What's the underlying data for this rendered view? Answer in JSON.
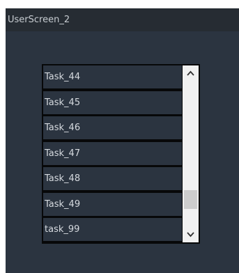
{
  "window": {
    "title": "UserScreen_2"
  },
  "list": {
    "items": [
      {
        "label": "Task_44"
      },
      {
        "label": "Task_45"
      },
      {
        "label": "Task_46"
      },
      {
        "label": "Task_47"
      },
      {
        "label": "Task_48"
      },
      {
        "label": "Task_49"
      },
      {
        "label": "task_99"
      }
    ]
  },
  "scrollbar": {
    "up_icon": "chevron-up-icon",
    "down_icon": "chevron-down-icon"
  },
  "colors": {
    "window_background": "#2b3440",
    "titlebar_background": "#262c33",
    "list_border": "#070809",
    "text": "#d6dadf",
    "scrollbar_track": "#f1f1f1",
    "scrollbar_thumb": "#cdcdcd"
  }
}
